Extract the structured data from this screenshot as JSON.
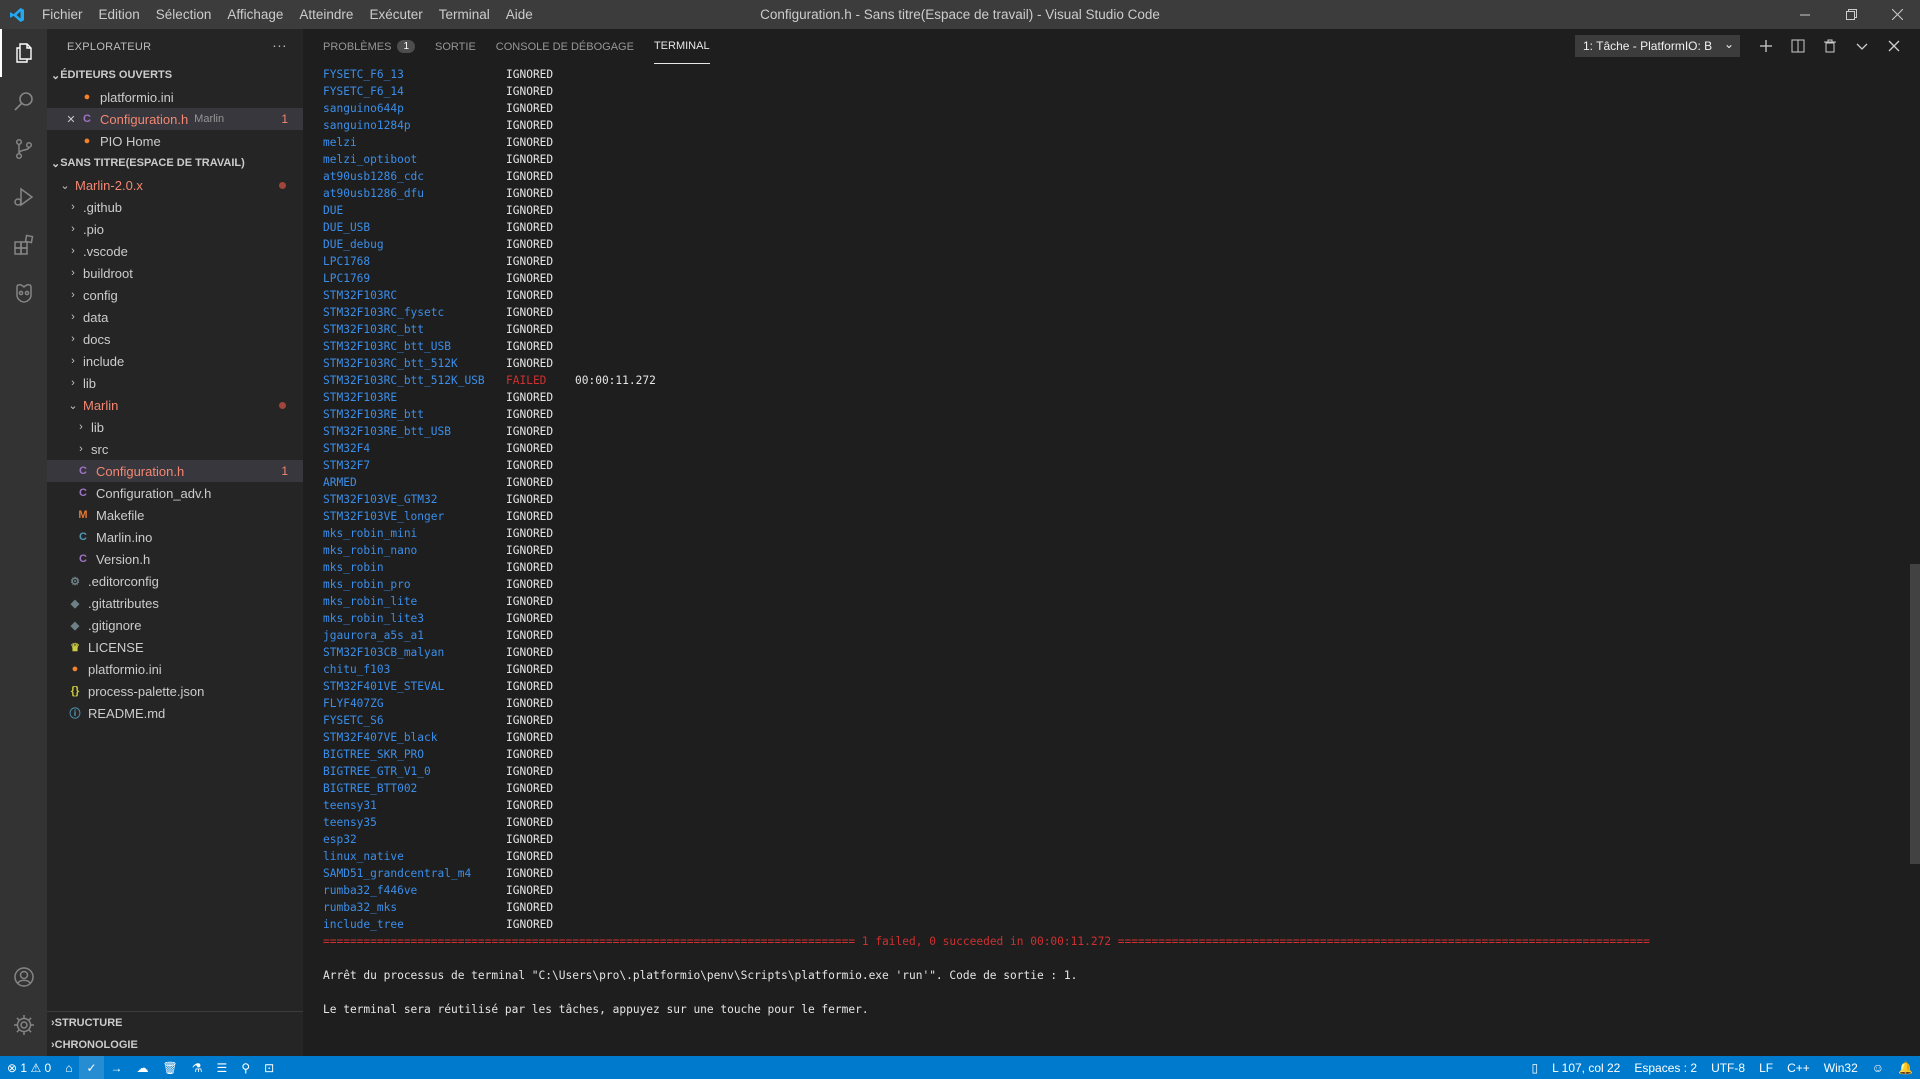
{
  "app": {
    "window_title": "Configuration.h - Sans titre(Espace de travail) - Visual Studio Code",
    "menu": [
      "Fichier",
      "Edition",
      "Sélection",
      "Affichage",
      "Atteindre",
      "Exécuter",
      "Terminal",
      "Aide"
    ]
  },
  "colors": {
    "accent": "#007acc",
    "error": "#f48771",
    "failed": "#cd3131",
    "link": "#3b8eea"
  },
  "activity_bar": [
    "files-icon",
    "search-icon",
    "source-control-icon",
    "run-debug-icon",
    "extensions-icon",
    "platformio-icon",
    "account-icon",
    "settings-gear-icon"
  ],
  "sidebar": {
    "title": "EXPLORATEUR",
    "open_editors_title": "ÉDITEURS OUVERTS",
    "open_editors": [
      {
        "icon": "platformio-icon",
        "label": "platformio.ini",
        "hint": "",
        "badge": ""
      },
      {
        "icon": "c-file-icon",
        "label": "Configuration.h",
        "hint": "Marlin",
        "badge": "1"
      },
      {
        "icon": "platformio-icon",
        "label": "PIO Home",
        "hint": "",
        "badge": ""
      }
    ],
    "workspace_title": "SANS TITRE(ESPACE DE TRAVAIL)",
    "root_folder": "Marlin-2.0.x",
    "folders": [
      ".github",
      ".pio",
      ".vscode",
      "buildroot",
      "config",
      "data",
      "docs",
      "include",
      "lib"
    ],
    "marlin_folder": "Marlin",
    "marlin_subfolders": [
      "lib",
      "src"
    ],
    "marlin_files": [
      {
        "icon": "c-file-icon",
        "label": "Configuration.h",
        "badge": "1"
      },
      {
        "icon": "c-file-icon",
        "label": "Configuration_adv.h",
        "badge": ""
      },
      {
        "icon": "makefile-icon",
        "label": "Makefile",
        "badge": ""
      },
      {
        "icon": "cpp-file-icon",
        "label": "Marlin.ino",
        "badge": ""
      },
      {
        "icon": "c-file-icon",
        "label": "Version.h",
        "badge": ""
      }
    ],
    "root_files": [
      {
        "icon": "gear-icon",
        "label": ".editorconfig"
      },
      {
        "icon": "git-icon",
        "label": ".gitattributes"
      },
      {
        "icon": "git-icon",
        "label": ".gitignore"
      },
      {
        "icon": "license-icon",
        "label": "LICENSE"
      },
      {
        "icon": "platformio-icon",
        "label": "platformio.ini"
      },
      {
        "icon": "json-icon",
        "label": "process-palette.json"
      },
      {
        "icon": "info-icon",
        "label": "README.md"
      }
    ],
    "structure_title": "STRUCTURE",
    "timeline_title": "CHRONOLOGIE"
  },
  "panel": {
    "tabs": [
      {
        "label": "PROBLÈMES",
        "count": "1"
      },
      {
        "label": "SORTIE",
        "count": ""
      },
      {
        "label": "CONSOLE DE DÉBOGAGE",
        "count": ""
      },
      {
        "label": "TERMINAL",
        "count": ""
      }
    ],
    "task_select": "1: Tâche - PlatformIO: B",
    "terminal_rows": [
      {
        "env": "FYSETC_F6_13",
        "status": "IGNORED",
        "time": ""
      },
      {
        "env": "FYSETC_F6_14",
        "status": "IGNORED",
        "time": ""
      },
      {
        "env": "sanguino644p",
        "status": "IGNORED",
        "time": ""
      },
      {
        "env": "sanguino1284p",
        "status": "IGNORED",
        "time": ""
      },
      {
        "env": "melzi",
        "status": "IGNORED",
        "time": ""
      },
      {
        "env": "melzi_optiboot",
        "status": "IGNORED",
        "time": ""
      },
      {
        "env": "at90usb1286_cdc",
        "status": "IGNORED",
        "time": ""
      },
      {
        "env": "at90usb1286_dfu",
        "status": "IGNORED",
        "time": ""
      },
      {
        "env": "DUE",
        "status": "IGNORED",
        "time": ""
      },
      {
        "env": "DUE_USB",
        "status": "IGNORED",
        "time": ""
      },
      {
        "env": "DUE_debug",
        "status": "IGNORED",
        "time": ""
      },
      {
        "env": "LPC1768",
        "status": "IGNORED",
        "time": ""
      },
      {
        "env": "LPC1769",
        "status": "IGNORED",
        "time": ""
      },
      {
        "env": "STM32F103RC",
        "status": "IGNORED",
        "time": ""
      },
      {
        "env": "STM32F103RC_fysetc",
        "status": "IGNORED",
        "time": ""
      },
      {
        "env": "STM32F103RC_btt",
        "status": "IGNORED",
        "time": ""
      },
      {
        "env": "STM32F103RC_btt_USB",
        "status": "IGNORED",
        "time": ""
      },
      {
        "env": "STM32F103RC_btt_512K",
        "status": "IGNORED",
        "time": ""
      },
      {
        "env": "STM32F103RC_btt_512K_USB",
        "status": "FAILED",
        "time": "00:00:11.272"
      },
      {
        "env": "STM32F103RE",
        "status": "IGNORED",
        "time": ""
      },
      {
        "env": "STM32F103RE_btt",
        "status": "IGNORED",
        "time": ""
      },
      {
        "env": "STM32F103RE_btt_USB",
        "status": "IGNORED",
        "time": ""
      },
      {
        "env": "STM32F4",
        "status": "IGNORED",
        "time": ""
      },
      {
        "env": "STM32F7",
        "status": "IGNORED",
        "time": ""
      },
      {
        "env": "ARMED",
        "status": "IGNORED",
        "time": ""
      },
      {
        "env": "STM32F103VE_GTM32",
        "status": "IGNORED",
        "time": ""
      },
      {
        "env": "STM32F103VE_longer",
        "status": "IGNORED",
        "time": ""
      },
      {
        "env": "mks_robin_mini",
        "status": "IGNORED",
        "time": ""
      },
      {
        "env": "mks_robin_nano",
        "status": "IGNORED",
        "time": ""
      },
      {
        "env": "mks_robin",
        "status": "IGNORED",
        "time": ""
      },
      {
        "env": "mks_robin_pro",
        "status": "IGNORED",
        "time": ""
      },
      {
        "env": "mks_robin_lite",
        "status": "IGNORED",
        "time": ""
      },
      {
        "env": "mks_robin_lite3",
        "status": "IGNORED",
        "time": ""
      },
      {
        "env": "jgaurora_a5s_a1",
        "status": "IGNORED",
        "time": ""
      },
      {
        "env": "STM32F103CB_malyan",
        "status": "IGNORED",
        "time": ""
      },
      {
        "env": "chitu_f103",
        "status": "IGNORED",
        "time": ""
      },
      {
        "env": "STM32F401VE_STEVAL",
        "status": "IGNORED",
        "time": ""
      },
      {
        "env": "FLYF407ZG",
        "status": "IGNORED",
        "time": ""
      },
      {
        "env": "FYSETC_S6",
        "status": "IGNORED",
        "time": ""
      },
      {
        "env": "STM32F407VE_black",
        "status": "IGNORED",
        "time": ""
      },
      {
        "env": "BIGTREE_SKR_PRO",
        "status": "IGNORED",
        "time": ""
      },
      {
        "env": "BIGTREE_GTR_V1_0",
        "status": "IGNORED",
        "time": ""
      },
      {
        "env": "BIGTREE_BTT002",
        "status": "IGNORED",
        "time": ""
      },
      {
        "env": "teensy31",
        "status": "IGNORED",
        "time": ""
      },
      {
        "env": "teensy35",
        "status": "IGNORED",
        "time": ""
      },
      {
        "env": "esp32",
        "status": "IGNORED",
        "time": ""
      },
      {
        "env": "linux_native",
        "status": "IGNORED",
        "time": ""
      },
      {
        "env": "SAMD51_grandcentral_m4",
        "status": "IGNORED",
        "time": ""
      },
      {
        "env": "rumba32_f446ve",
        "status": "IGNORED",
        "time": ""
      },
      {
        "env": "rumba32_mks",
        "status": "IGNORED",
        "time": ""
      },
      {
        "env": "include_tree",
        "status": "IGNORED",
        "time": ""
      }
    ],
    "summary": "1 failed, 0 succeeded in 00:00:11.272",
    "exit_line": "Arrêt du processus de terminal \"C:\\Users\\pro\\.platformio\\penv\\Scripts\\platformio.exe 'run'\". Code de sortie : 1.",
    "reuse_line": "Le terminal sera réutilisé par les tâches, appuyez sur une touche pour le fermer."
  },
  "status_bar": {
    "errors": "1",
    "warnings": "0",
    "position": "L 107, col 22",
    "spaces": "Espaces : 2",
    "encoding": "UTF-8",
    "eol": "LF",
    "language": "C++",
    "platform": "Win32"
  }
}
